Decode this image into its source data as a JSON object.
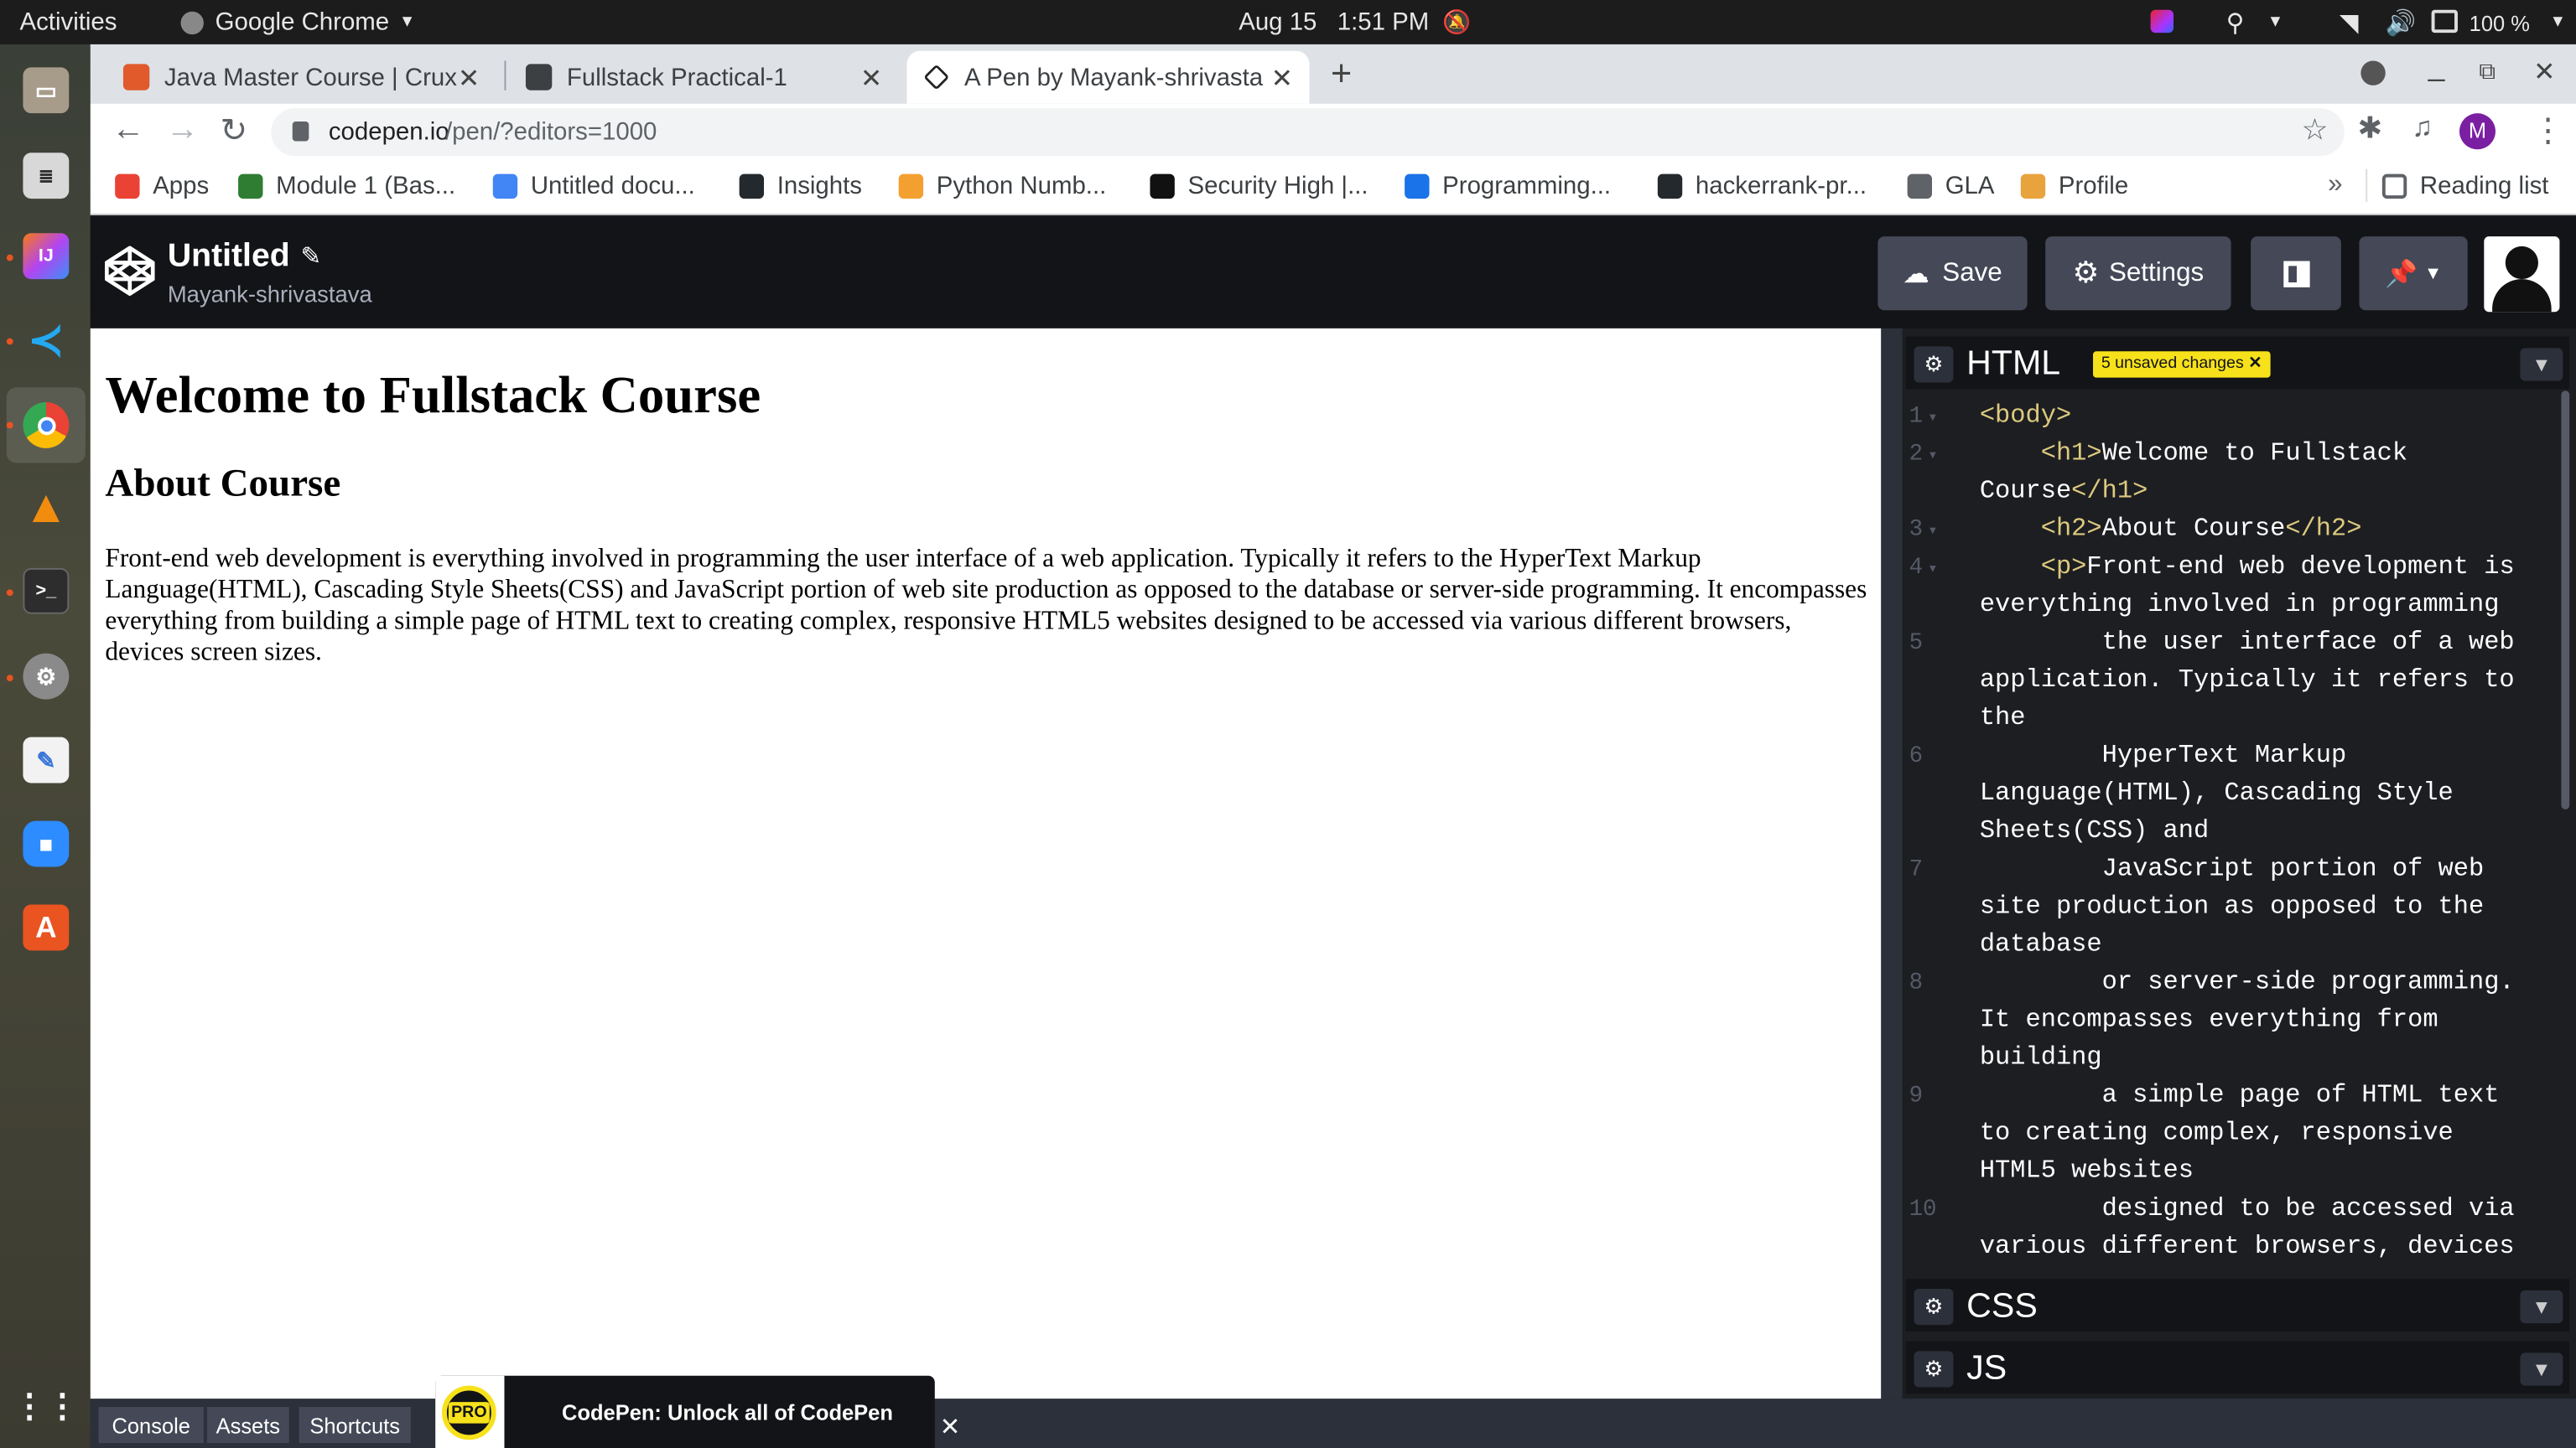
{
  "system": {
    "activities": "Activities",
    "app_name": "Google Chrome",
    "date": "Aug 15",
    "time": "1:51 PM",
    "battery": "100 %"
  },
  "browser": {
    "tabs": [
      {
        "title": "Java Master Course | Crux"
      },
      {
        "title": "Fullstack Practical-1"
      },
      {
        "title": "A Pen by Mayank-shrivasta"
      }
    ],
    "url_host": "codepen.io",
    "url_path": "/pen/?editors=1000",
    "profile_initial": "M",
    "bookmarks": [
      {
        "label": "Apps",
        "color": "#ea4335"
      },
      {
        "label": "Module 1 (Bas...",
        "color": "#2e7d32"
      },
      {
        "label": "Untitled docu...",
        "color": "#4285f4"
      },
      {
        "label": "Insights",
        "color": "#24292e"
      },
      {
        "label": "Python Numb...",
        "color": "#f4a031"
      },
      {
        "label": "Security High |...",
        "color": "#111111"
      },
      {
        "label": "Programming...",
        "color": "#1a73e8"
      },
      {
        "label": "hackerrank-pr...",
        "color": "#24292e"
      },
      {
        "label": "GLA",
        "color": "#5f6368"
      },
      {
        "label": "Profile",
        "color": "#e8a33d"
      }
    ],
    "overflow": "»",
    "reading_list": "Reading list"
  },
  "codepen": {
    "pen_title": "Untitled",
    "author": "Mayank-shrivastava",
    "save_label": "Save",
    "settings_label": "Settings",
    "unsaved_badge": "5 unsaved changes",
    "panels": {
      "html": "HTML",
      "css": "CSS",
      "js": "JS"
    },
    "footer": {
      "console": "Console",
      "assets": "Assets",
      "shortcuts": "Shortcuts",
      "pro_badge": "PRO",
      "promo": "CodePen: Unlock all of CodePen"
    }
  },
  "preview": {
    "h1": "Welcome to Fullstack Course",
    "h2": "About Course",
    "p": "Front-end web development is everything involved in programming the user interface of a web application. Typically it refers to the HyperText Markup Language(HTML), Cascading Style Sheets(CSS) and JavaScript portion of web site production as opposed to the database or server-side programming. It encompasses everything from building a simple page of HTML text to creating complex, responsive HTML5 websites designed to be accessed via various different browsers, devices screen sizes."
  },
  "code": {
    "lines": [
      {
        "n": "1",
        "fold": "▾",
        "rows": [
          {
            "tag1": "<body>",
            "text": "",
            "tag2": ""
          }
        ]
      },
      {
        "n": "2",
        "fold": "▾",
        "rows": [
          {
            "tag1": "    <h1>",
            "text": "Welcome to Fullstack",
            "tag2": ""
          },
          {
            "tag1": "",
            "text": "Course",
            "tag2": "</h1>"
          }
        ]
      },
      {
        "n": "3",
        "fold": "▾",
        "rows": [
          {
            "tag1": "    <h2>",
            "text": "About Course",
            "tag2": "</h2>"
          }
        ]
      },
      {
        "n": "4",
        "fold": "▾",
        "rows": [
          {
            "tag1": "    <p>",
            "text": "Front-end web development is",
            "tag2": ""
          },
          {
            "tag1": "",
            "text": "everything involved in programming",
            "tag2": ""
          }
        ]
      },
      {
        "n": "5",
        "fold": "",
        "rows": [
          {
            "tag1": "",
            "text": "        the user interface of a web",
            "tag2": ""
          },
          {
            "tag1": "",
            "text": "application. Typically it refers to",
            "tag2": ""
          },
          {
            "tag1": "",
            "text": "the",
            "tag2": ""
          }
        ]
      },
      {
        "n": "6",
        "fold": "",
        "rows": [
          {
            "tag1": "",
            "text": "        HyperText Markup",
            "tag2": ""
          },
          {
            "tag1": "",
            "text": "Language(HTML), Cascading Style",
            "tag2": ""
          },
          {
            "tag1": "",
            "text": "Sheets(CSS) and",
            "tag2": ""
          }
        ]
      },
      {
        "n": "7",
        "fold": "",
        "rows": [
          {
            "tag1": "",
            "text": "        JavaScript portion of web",
            "tag2": ""
          },
          {
            "tag1": "",
            "text": "site production as opposed to the",
            "tag2": ""
          },
          {
            "tag1": "",
            "text": "database",
            "tag2": ""
          }
        ]
      },
      {
        "n": "8",
        "fold": "",
        "rows": [
          {
            "tag1": "",
            "text": "        or server-side programming.",
            "tag2": ""
          },
          {
            "tag1": "",
            "text": "It encompasses everything from",
            "tag2": ""
          },
          {
            "tag1": "",
            "text": "building",
            "tag2": ""
          }
        ]
      },
      {
        "n": "9",
        "fold": "",
        "rows": [
          {
            "tag1": "",
            "text": "        a simple page of HTML text",
            "tag2": ""
          },
          {
            "tag1": "",
            "text": "to creating complex, responsive",
            "tag2": ""
          },
          {
            "tag1": "",
            "text": "HTML5 websites",
            "tag2": ""
          }
        ]
      },
      {
        "n": "10",
        "fold": "",
        "rows": [
          {
            "tag1": "",
            "text": "        designed to be accessed via",
            "tag2": ""
          },
          {
            "tag1": "",
            "text": "various different browsers, devices",
            "tag2": ""
          }
        ]
      }
    ]
  }
}
